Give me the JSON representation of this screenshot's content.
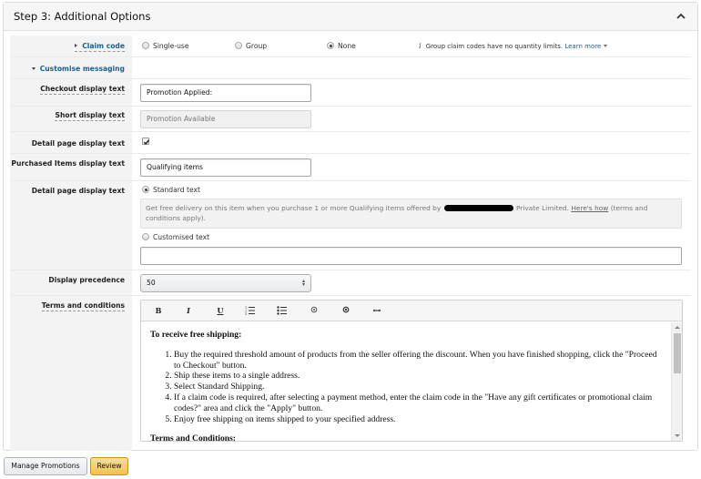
{
  "panel": {
    "title": "Step 3: Additional Options",
    "collapse_icon": "chevron-up-icon"
  },
  "claim_code": {
    "label": "Claim code",
    "options": [
      {
        "label": "Single-use",
        "checked": false
      },
      {
        "label": "Group",
        "checked": false
      },
      {
        "label": "None",
        "checked": true
      }
    ],
    "info_icon": "info-icon",
    "info_text": "Group claim codes have no quantity limits.",
    "learn_more": "Learn more"
  },
  "customise_messaging": {
    "label": "Customise messaging"
  },
  "checkout_display_text": {
    "label": "Checkout display text",
    "value": "Promotion Applied:"
  },
  "short_display_text": {
    "label": "Short display text",
    "value": "Promotion Available"
  },
  "detail_page_checkbox": {
    "label": "Detail page display text",
    "checked": true
  },
  "purchased_items_display_text": {
    "label": "Purchased Items display text",
    "value": "Qualifying items"
  },
  "detail_page_display_text": {
    "label": "Detail page display text",
    "standard_option": {
      "label": "Standard text",
      "checked": true
    },
    "standard_text_before": "Get free delivery on this item when you purchase 1 or more Qualifying items offered by",
    "standard_text_after": "Private Limited.",
    "heres_how": "Here's how",
    "standard_text_tail": "(terms and conditions apply).",
    "custom_option": {
      "label": "Customised text",
      "checked": false
    },
    "custom_value": ""
  },
  "display_precedence": {
    "label": "Display precedence",
    "selected": "50"
  },
  "terms_and_conditions": {
    "label": "Terms and conditions",
    "toolbar": [
      {
        "name": "bold-icon",
        "glyph": "B"
      },
      {
        "name": "italic-icon",
        "glyph": "I"
      },
      {
        "name": "underline-icon",
        "glyph": "U"
      },
      {
        "name": "numbered-list-icon",
        "glyph": ""
      },
      {
        "name": "bullet-list-icon",
        "glyph": ""
      },
      {
        "name": "outdent-icon",
        "glyph": ""
      },
      {
        "name": "indent-icon",
        "glyph": ""
      },
      {
        "name": "link-icon",
        "glyph": ""
      }
    ],
    "heading": "To receive free shipping:",
    "steps": [
      "Buy the required threshold amount of products from the seller offering the discount. When you have finished shopping, click the \"Proceed to Checkout\" button.",
      "Ship these items to a single address.",
      "Select Standard Shipping.",
      "If a claim code is required, after selecting a payment method, enter the claim code in the \"Have any gift certificates or promotional claim codes?\" area and click the \"Apply\" button.",
      "Enjoy free shipping on items shipped to your specified address."
    ],
    "subheading": "Terms and Conditions:"
  },
  "footer": {
    "manage_promotions": "Manage Promotions",
    "review": "Review"
  },
  "colors": {
    "link": "#1b5e8e",
    "primary_button": "#f0c14b",
    "label_bg": "#f3f3f3"
  }
}
